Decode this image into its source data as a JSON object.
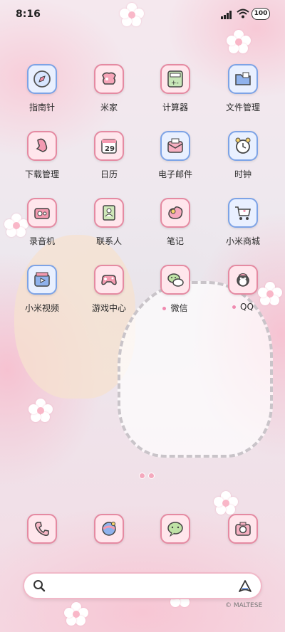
{
  "status_bar": {
    "time": "8:16",
    "battery": "100"
  },
  "apps": [
    {
      "label": "指南针",
      "icon": "compass-icon"
    },
    {
      "label": "米家",
      "icon": "home-icon"
    },
    {
      "label": "计算器",
      "icon": "calculator-icon"
    },
    {
      "label": "文件管理",
      "icon": "folder-icon"
    },
    {
      "label": "下载管理",
      "icon": "download-icon"
    },
    {
      "label": "日历",
      "icon": "calendar-icon",
      "date": "29"
    },
    {
      "label": "电子邮件",
      "icon": "mail-icon"
    },
    {
      "label": "时钟",
      "icon": "clock-icon"
    },
    {
      "label": "录音机",
      "icon": "recorder-icon"
    },
    {
      "label": "联系人",
      "icon": "contacts-icon"
    },
    {
      "label": "笔记",
      "icon": "notes-icon"
    },
    {
      "label": "小米商城",
      "icon": "cart-icon"
    },
    {
      "label": "小米视频",
      "icon": "video-icon"
    },
    {
      "label": "游戏中心",
      "icon": "gamepad-icon"
    },
    {
      "label": "微信",
      "icon": "wechat-icon"
    },
    {
      "label": "QQ",
      "icon": "qq-icon"
    }
  ],
  "dock": [
    {
      "icon": "phone-icon"
    },
    {
      "icon": "browser-icon"
    },
    {
      "icon": "messages-icon"
    },
    {
      "icon": "camera-icon"
    }
  ],
  "credit": "© MALTESE"
}
